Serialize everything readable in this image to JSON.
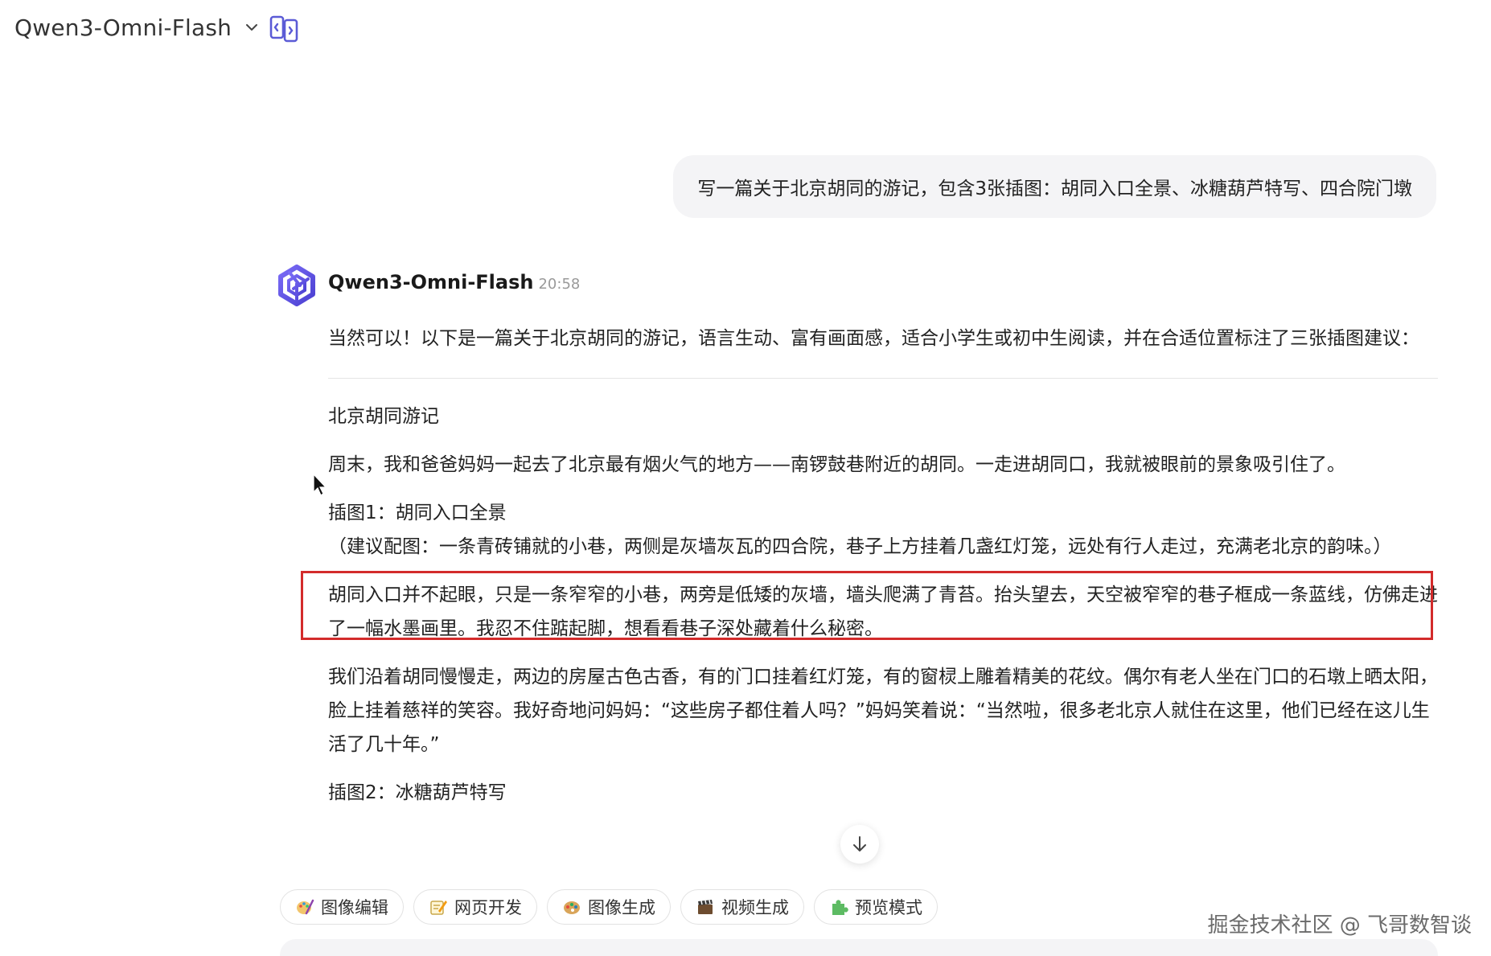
{
  "header": {
    "model_name": "Qwen3-Omni-Flash"
  },
  "user_message": "写一篇关于北京胡同的游记，包含3张插图：胡同入口全景、冰糖葫芦特写、四合院门墩",
  "assistant": {
    "name": "Qwen3-Omni-Flash",
    "time": "20:58",
    "intro": "当然可以！以下是一篇关于北京胡同的游记，语言生动、富有画面感，适合小学生或初中生阅读，并在合适位置标注了三张插图建议：",
    "title": "北京胡同游记",
    "para1": "周末，我和爸爸妈妈一起去了北京最有烟火气的地方——南锣鼓巷附近的胡同。一走进胡同口，我就被眼前的景象吸引住了。",
    "caption1": "插图1：胡同入口全景",
    "suggestion1": "（建议配图：一条青砖铺就的小巷，两侧是灰墙灰瓦的四合院，巷子上方挂着几盏红灯笼，远处有行人走过，充满老北京的韵味。）",
    "para2": "胡同入口并不起眼，只是一条窄窄的小巷，两旁是低矮的灰墙，墙头爬满了青苔。抬头望去，天空被窄窄的巷子框成一条蓝线，仿佛走进了一幅水墨画里。我忍不住踮起脚，想看看巷子深处藏着什么秘密。",
    "para3": "我们沿着胡同慢慢走，两边的房屋古色古香，有的门口挂着红灯笼，有的窗棂上雕着精美的花纹。偶尔有老人坐在门口的石墩上晒太阳，脸上挂着慈祥的笑容。我好奇地问妈妈：“这些房子都住着人吗？”妈妈笑着说：“当然啦，很多老北京人就住在这里，他们已经在这儿生活了几十年。”",
    "caption2": "插图2：冰糖葫芦特写"
  },
  "chips": [
    {
      "label": "图像编辑",
      "icon": "palette-brush-icon"
    },
    {
      "label": "网页开发",
      "icon": "pencil-note-icon"
    },
    {
      "label": "图像生成",
      "icon": "paint-palette-icon"
    },
    {
      "label": "视频生成",
      "icon": "film-clapper-icon"
    },
    {
      "label": "预览模式",
      "icon": "puzzle-icon"
    }
  ],
  "watermark": "掘金技术社区 @ 飞哥数智谈",
  "colors": {
    "accent": "#5b5bd6",
    "highlight_border": "#d32b2b",
    "bubble_bg": "#f4f4f6"
  }
}
